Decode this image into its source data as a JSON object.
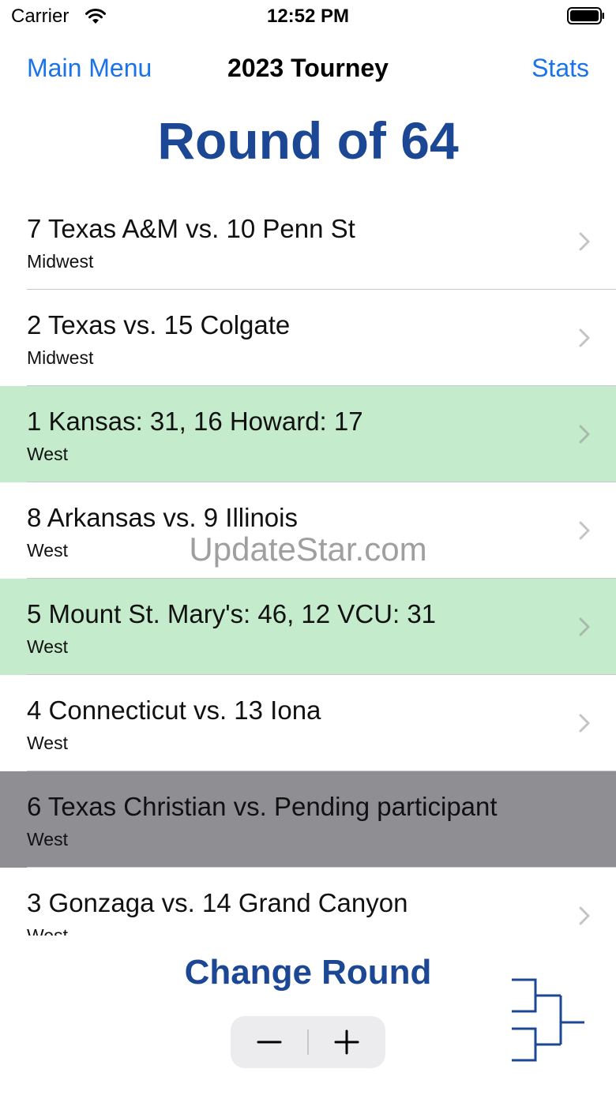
{
  "status_bar": {
    "carrier": "Carrier",
    "time": "12:52 PM"
  },
  "nav": {
    "left": "Main Menu",
    "title": "2023 Tourney",
    "right": "Stats"
  },
  "round_title": "Round of 64",
  "games": [
    {
      "matchup": "7 Texas A&M vs. 10 Penn St",
      "region": "Midwest",
      "status": "scheduled"
    },
    {
      "matchup": "2 Texas vs. 15 Colgate",
      "region": "Midwest",
      "status": "scheduled"
    },
    {
      "matchup": "1 Kansas:  31, 16 Howard:  17",
      "region": "West",
      "status": "final"
    },
    {
      "matchup": "8 Arkansas vs. 9 Illinois",
      "region": "West",
      "status": "scheduled"
    },
    {
      "matchup": "5 Mount St. Mary's:  46, 12 VCU:  31",
      "region": "West",
      "status": "final"
    },
    {
      "matchup": "4 Connecticut vs. 13 Iona",
      "region": "West",
      "status": "scheduled"
    },
    {
      "matchup": "6 Texas Christian vs. Pending participant",
      "region": "West",
      "status": "pending"
    },
    {
      "matchup": "3 Gonzaga vs. 14 Grand Canyon",
      "region": "West",
      "status": "scheduled"
    }
  ],
  "watermark": "UpdateStar.com",
  "bottom": {
    "change_round_label": "Change Round",
    "stepper_icons": [
      "minus-icon",
      "plus-icon"
    ],
    "bracket_icon": "bracket-icon"
  },
  "colors": {
    "accent_blue": "#1a73e8",
    "title_navy": "#1c4794",
    "final_row": "#c4ebcc",
    "pending_row": "#8e8e93"
  }
}
